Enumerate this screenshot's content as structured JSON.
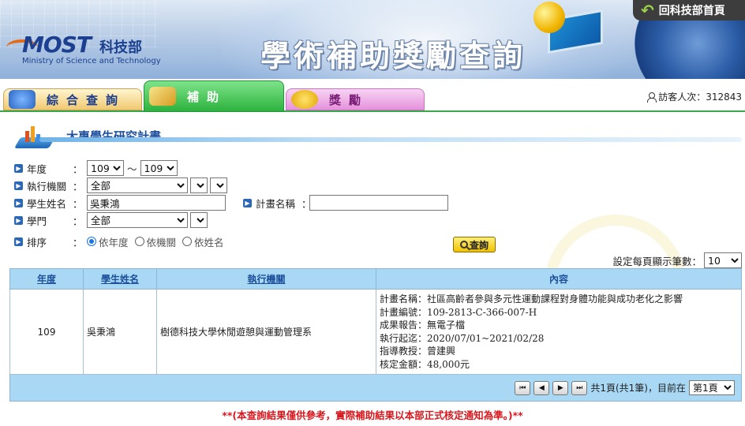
{
  "header": {
    "logo_text": "MOST",
    "logo_cn": "科技部",
    "logo_en": "Ministry of Science and Technology",
    "title": "學術補助獎勵查詢",
    "home_button": "回科技部首頁"
  },
  "tabs": [
    {
      "label": "綜合查詢"
    },
    {
      "label": "補助"
    },
    {
      "label": "獎勵"
    }
  ],
  "visitor": {
    "label": "訪客人次：312843"
  },
  "section": {
    "title": "大專學生研究計畫"
  },
  "form": {
    "year_label": "年度",
    "year_from": "109",
    "year_to": "109",
    "tilde": "～",
    "org_label": "執行機關",
    "org_value": "全部",
    "student_label": "學生姓名",
    "student_value": "吳秉鴻",
    "plan_label": "計畫名稱",
    "plan_value": "",
    "field_label": "學門",
    "field_value": "全部",
    "sort_label": "排序",
    "sort_options": [
      "依年度",
      "依機關",
      "依姓名"
    ],
    "sort_selected": "依年度",
    "query_button": "查詢",
    "colon": "：",
    "perpage_label": "設定每頁顯示筆數：",
    "perpage_value": "10"
  },
  "table": {
    "headers": [
      "年度",
      "學生姓名",
      "執行機關",
      "內容"
    ],
    "rows": [
      {
        "year": "109",
        "student": "吳秉鴻",
        "org": "樹德科技大學休閒遊憩與運動管理系",
        "content": [
          "計畫名稱：社區高齡者參與多元性運動課程對身體功能與成功老化之影響",
          "計畫編號：109-2813-C-366-007-H",
          "成果報告：無電子檔",
          "執行起迄：2020/07/01~2021/02/28",
          "指導教授：曾建興",
          "核定金額：48,000元"
        ]
      }
    ]
  },
  "pager": {
    "summary": "共1頁(共1筆)，目前在",
    "current_page": "第1頁"
  },
  "disclaimer": "**(本查詢結果僅供參考，實際補助結果以本部正式核定通知為準。)**"
}
